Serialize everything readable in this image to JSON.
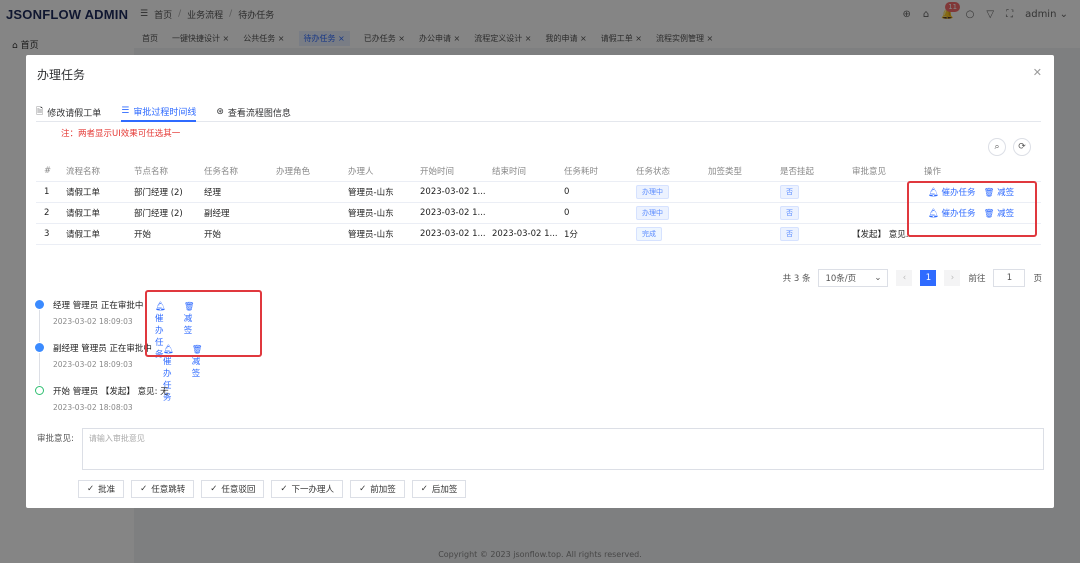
{
  "app": {
    "logo": "JSONFLOW ADMIN",
    "breadcrumb": [
      "首页",
      "业务流程",
      "待办任务"
    ],
    "notifications": "11",
    "user": "admin",
    "sidebar_home": "首页",
    "footer": "Copyright © 2023 jsonflow.top. All rights reserved."
  },
  "tabs": [
    {
      "label": "首页",
      "closable": false,
      "active": false
    },
    {
      "label": "一键快捷设计 ×",
      "active": false
    },
    {
      "label": "公共任务 ×",
      "active": false
    },
    {
      "label": "待办任务 ×",
      "active": true
    },
    {
      "label": "已办任务 ×",
      "active": false
    },
    {
      "label": "办公申请 ×",
      "active": false
    },
    {
      "label": "流程定义设计 ×",
      "active": false
    },
    {
      "label": "我的申请 ×",
      "active": false
    },
    {
      "label": "请假工单 ×",
      "active": false
    },
    {
      "label": "流程实例管理 ×",
      "active": false
    }
  ],
  "modal": {
    "title": "办理任务",
    "tabs": [
      "修改请假工单",
      "审批过程时间线",
      "查看流程图信息"
    ],
    "note": "注：两者显示UI效果可任选其一",
    "table": {
      "headers": [
        "#",
        "流程名称",
        "节点名称",
        "任务名称",
        "办理角色",
        "办理人",
        "开始时间",
        "结束时间",
        "任务耗时",
        "任务状态",
        "加签类型",
        "是否挂起",
        "审批意见",
        "操作"
      ],
      "rows": [
        [
          "1",
          "请假工单",
          "部门经理 (2)",
          "经理",
          "",
          "管理员-山东",
          "2023-03-02 1...",
          "",
          "0",
          "办理中",
          "",
          "否",
          "",
          ""
        ],
        [
          "2",
          "请假工单",
          "部门经理 (2)",
          "副经理",
          "",
          "管理员-山东",
          "2023-03-02 1...",
          "",
          "0",
          "办理中",
          "",
          "否",
          "",
          ""
        ],
        [
          "3",
          "请假工单",
          "开始",
          "开始",
          "",
          "管理员-山东",
          "2023-03-02 1...",
          "2023-03-02 1...",
          "1分",
          "完成",
          "",
          "否",
          "【发起】 意见...",
          ""
        ]
      ],
      "op_urge": "催办任务",
      "op_reduce": "减签"
    },
    "pager": {
      "total": "共 3 条",
      "page_size": "10条/页",
      "current": "1",
      "goto_label": "前往",
      "goto_value": "1",
      "page_unit": "页"
    },
    "timeline": [
      {
        "text": "经理 管理员 正在审批中",
        "time": "2023-03-02 18:09:03"
      },
      {
        "text": "副经理 管理员 正在审批中",
        "time": "2023-03-02 18:09:03"
      },
      {
        "text": "开始 管理员 【发起】 意见: 无",
        "time": "2023-03-02 18:08:03"
      }
    ],
    "approval_label": "审批意见:",
    "approval_placeholder": "请输入审批意见",
    "actions": [
      "批准",
      "任意跳转",
      "任意驳回",
      "下一办理人",
      "前加签",
      "后加签"
    ]
  },
  "colors": {
    "accent": "#2f6bff",
    "highlight_box": "#e0383e",
    "note": "#e53935"
  }
}
